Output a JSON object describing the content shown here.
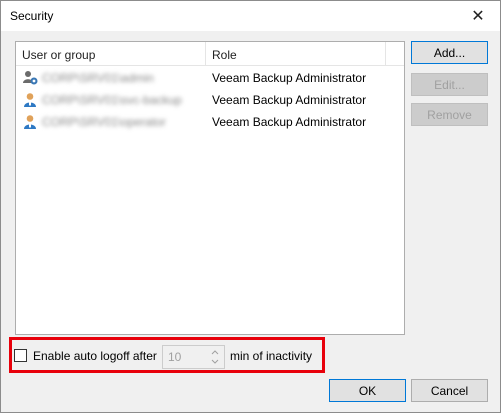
{
  "window": {
    "title": "Security",
    "close_glyph": "✕"
  },
  "list": {
    "columns": [
      "User or group",
      "Role"
    ],
    "rows": [
      {
        "user": "CORP\\SRV01\\admin",
        "role": "Veeam Backup Administrator",
        "icon": "user-group-icon"
      },
      {
        "user": "CORP\\SRV01\\svc-backup",
        "role": "Veeam Backup Administrator",
        "icon": "user-icon"
      },
      {
        "user": "CORP\\SRV01\\operator",
        "role": "Veeam Backup Administrator",
        "icon": "user-icon"
      }
    ]
  },
  "buttons": {
    "add": "Add...",
    "edit": "Edit...",
    "remove": "Remove",
    "ok": "OK",
    "cancel": "Cancel"
  },
  "auto_logoff": {
    "checkbox_label": "Enable auto logoff after",
    "checked": false,
    "minutes": "10",
    "after_label": "min of inactivity"
  },
  "colors": {
    "highlight": "#e8000b",
    "primary_border": "#0078d7"
  }
}
